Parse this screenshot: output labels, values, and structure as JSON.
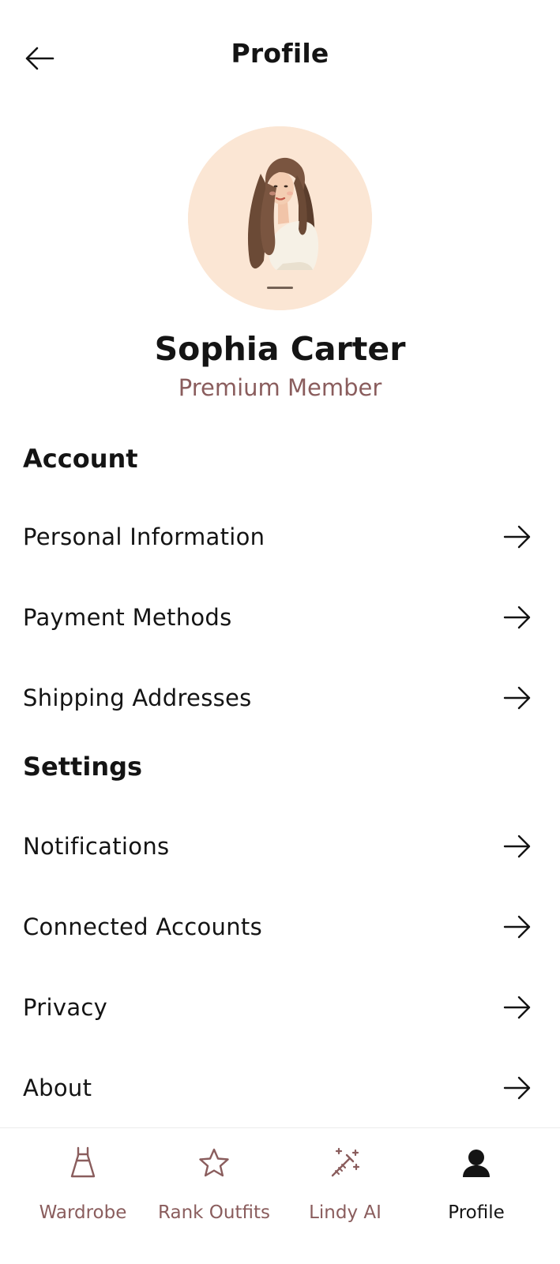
{
  "header": {
    "title": "Profile",
    "back_icon": "arrow-left-icon"
  },
  "profile": {
    "name": "Sophia Carter",
    "tier": "Premium Member",
    "avatar_bg": "#fbe6d4"
  },
  "sections": {
    "account": {
      "title": "Account",
      "items": [
        {
          "label": "Personal Information"
        },
        {
          "label": "Payment Methods"
        },
        {
          "label": "Shipping Addresses"
        }
      ]
    },
    "settings": {
      "title": "Settings",
      "items": [
        {
          "label": "Notifications"
        },
        {
          "label": "Connected Accounts"
        },
        {
          "label": "Privacy"
        },
        {
          "label": "About"
        }
      ]
    }
  },
  "nav": {
    "items": [
      {
        "label": "Wardrobe",
        "icon": "dress-icon"
      },
      {
        "label": "Rank Outfits",
        "icon": "star-icon"
      },
      {
        "label": "Lindy AI",
        "icon": "magic-wand-icon"
      },
      {
        "label": "Profile",
        "icon": "person-icon",
        "active": true
      }
    ]
  },
  "colors": {
    "accent": "#8a5d5d",
    "text": "#141414",
    "background": "#ffffff"
  }
}
